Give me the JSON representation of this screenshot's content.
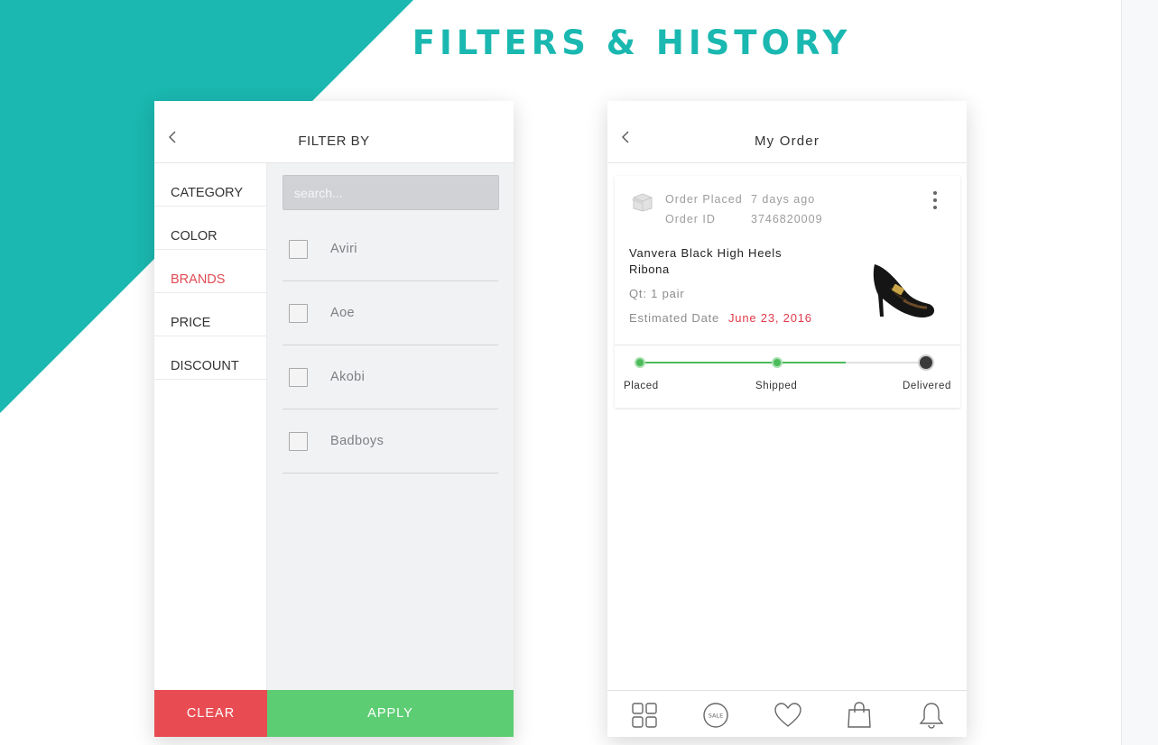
{
  "page": {
    "title": "FILTERS & HISTORY",
    "accent_color": "#1ab8b0"
  },
  "filter_screen": {
    "header_title": "FILTER BY",
    "back_icon": "chevron-left-icon",
    "categories": [
      {
        "label": "CATEGORY",
        "active": false
      },
      {
        "label": "COLOR",
        "active": false
      },
      {
        "label": "BRANDS",
        "active": true
      },
      {
        "label": "PRICE",
        "active": false
      },
      {
        "label": "DISCOUNT",
        "active": false
      }
    ],
    "active_color": "#e04b53",
    "search_placeholder": "search...",
    "brands": [
      {
        "label": "Aviri",
        "checked": false
      },
      {
        "label": "Aoe",
        "checked": false
      },
      {
        "label": "Akobi",
        "checked": false
      },
      {
        "label": "Badboys",
        "checked": false
      }
    ],
    "clear_label": "CLEAR",
    "clear_color": "#e84c52",
    "apply_label": "APPLY",
    "apply_color": "#5dcd74"
  },
  "order_screen": {
    "header_title": "My Order",
    "back_icon": "chevron-left-icon",
    "order": {
      "placed_label": "Order Placed",
      "placed_value": "7 days ago",
      "id_label": "Order ID",
      "id_value": "3746820009",
      "product_name": "Vanvera Black High Heels",
      "product_brand": "Ribona",
      "quantity": "Qt: 1 pair",
      "estimated_label": "Estimated Date",
      "estimated_date": "June 23, 2016",
      "estimated_color": "#e03a4a",
      "product_icon": "high-heel-shoe-icon",
      "box_icon": "package-box-icon",
      "more_icon": "more-vertical-icon"
    },
    "tracking": {
      "steps": [
        {
          "label": "Placed",
          "done": true
        },
        {
          "label": "Shipped",
          "done": true
        },
        {
          "label": "Delivered",
          "done": false
        }
      ],
      "progress_color": "#4cbb5a"
    },
    "tabbar": [
      {
        "icon": "grid-icon"
      },
      {
        "icon": "sale-badge-icon",
        "text": "SALE"
      },
      {
        "icon": "heart-icon"
      },
      {
        "icon": "shopping-bag-icon"
      },
      {
        "icon": "bell-icon"
      }
    ]
  }
}
